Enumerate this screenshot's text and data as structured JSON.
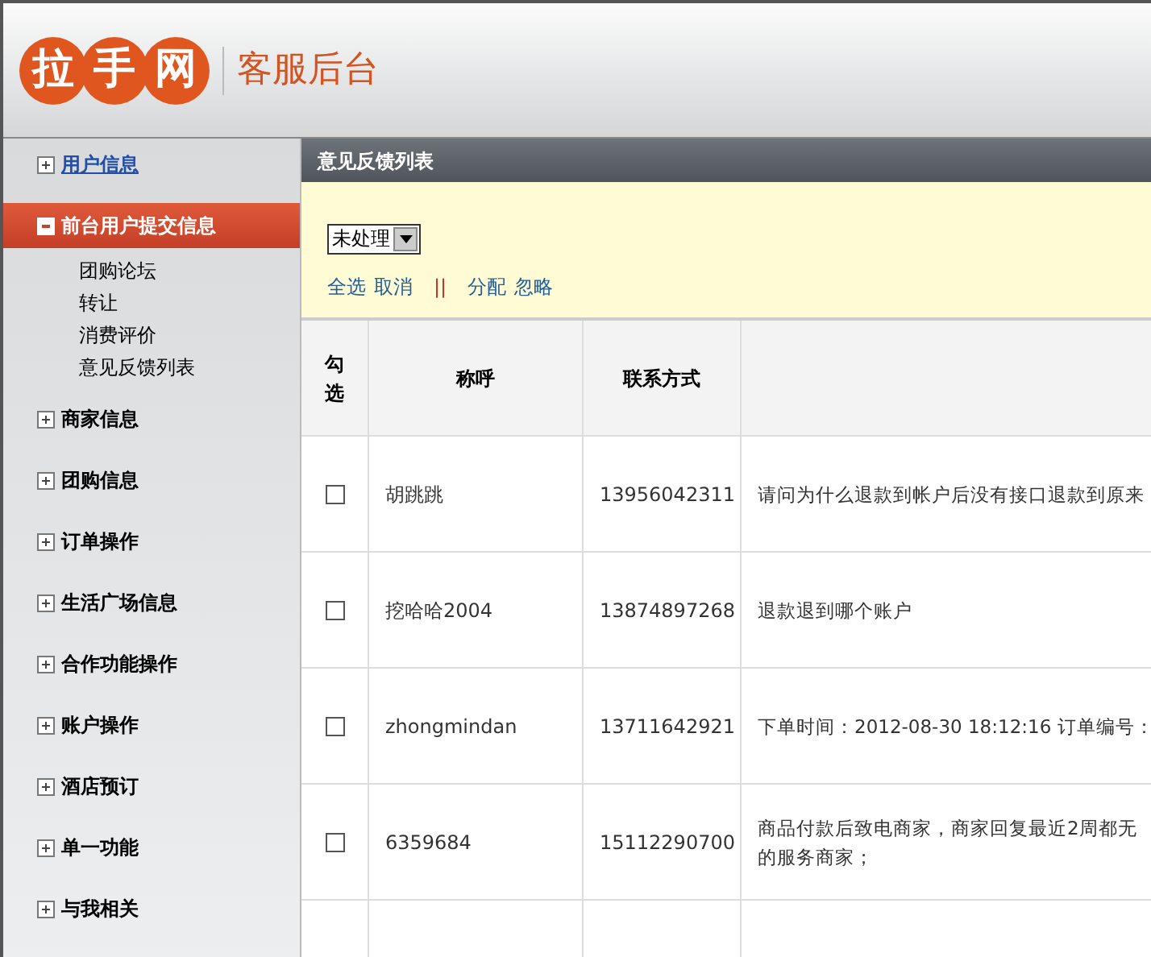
{
  "header": {
    "logo": "拉手网",
    "title": "客服后台"
  },
  "sidebar": {
    "items": [
      {
        "label": "用户信息",
        "expanded": false,
        "link": true
      },
      {
        "label": "前台用户提交信息",
        "expanded": true,
        "link": false,
        "children": [
          {
            "label": "团购论坛"
          },
          {
            "label": "转让"
          },
          {
            "label": "消费评价"
          },
          {
            "label": "意见反馈列表"
          }
        ]
      },
      {
        "label": "商家信息",
        "expanded": false,
        "link": false
      },
      {
        "label": "团购信息",
        "expanded": false,
        "link": false
      },
      {
        "label": "订单操作",
        "expanded": false,
        "link": false
      },
      {
        "label": "生活广场信息",
        "expanded": false,
        "link": false
      },
      {
        "label": "合作功能操作",
        "expanded": false,
        "link": false
      },
      {
        "label": "账户操作",
        "expanded": false,
        "link": false
      },
      {
        "label": "酒店预订",
        "expanded": false,
        "link": false
      },
      {
        "label": "单一功能",
        "expanded": false,
        "link": false
      },
      {
        "label": "与我相关",
        "expanded": false,
        "link": false
      }
    ]
  },
  "panel": {
    "title": "意见反馈列表",
    "status_select": "未处理",
    "actions": [
      "全选",
      "取消",
      "||",
      "分配",
      "忽略"
    ]
  },
  "table": {
    "columns": [
      "勾选",
      "称呼",
      "联系方式"
    ],
    "rows": [
      {
        "checked": false,
        "name": "胡跳跳",
        "contact": "13956042311",
        "content": [
          "请问为什么退款到帐户后没有接口退款到原来"
        ]
      },
      {
        "checked": false,
        "name": "挖哈哈2004",
        "contact": "13874897268",
        "content": [
          "退款退到哪个账户"
        ]
      },
      {
        "checked": false,
        "name": "zhongmindan",
        "contact": "13711642921",
        "content": [
          "下单时间：2012-08-30 18:12:16 订单编号："
        ]
      },
      {
        "checked": false,
        "name": "6359684",
        "contact": "15112290700",
        "content": [
          "商品付款后致电商家，商家回复最近2周都无",
          "的服务商家；"
        ]
      }
    ]
  }
}
